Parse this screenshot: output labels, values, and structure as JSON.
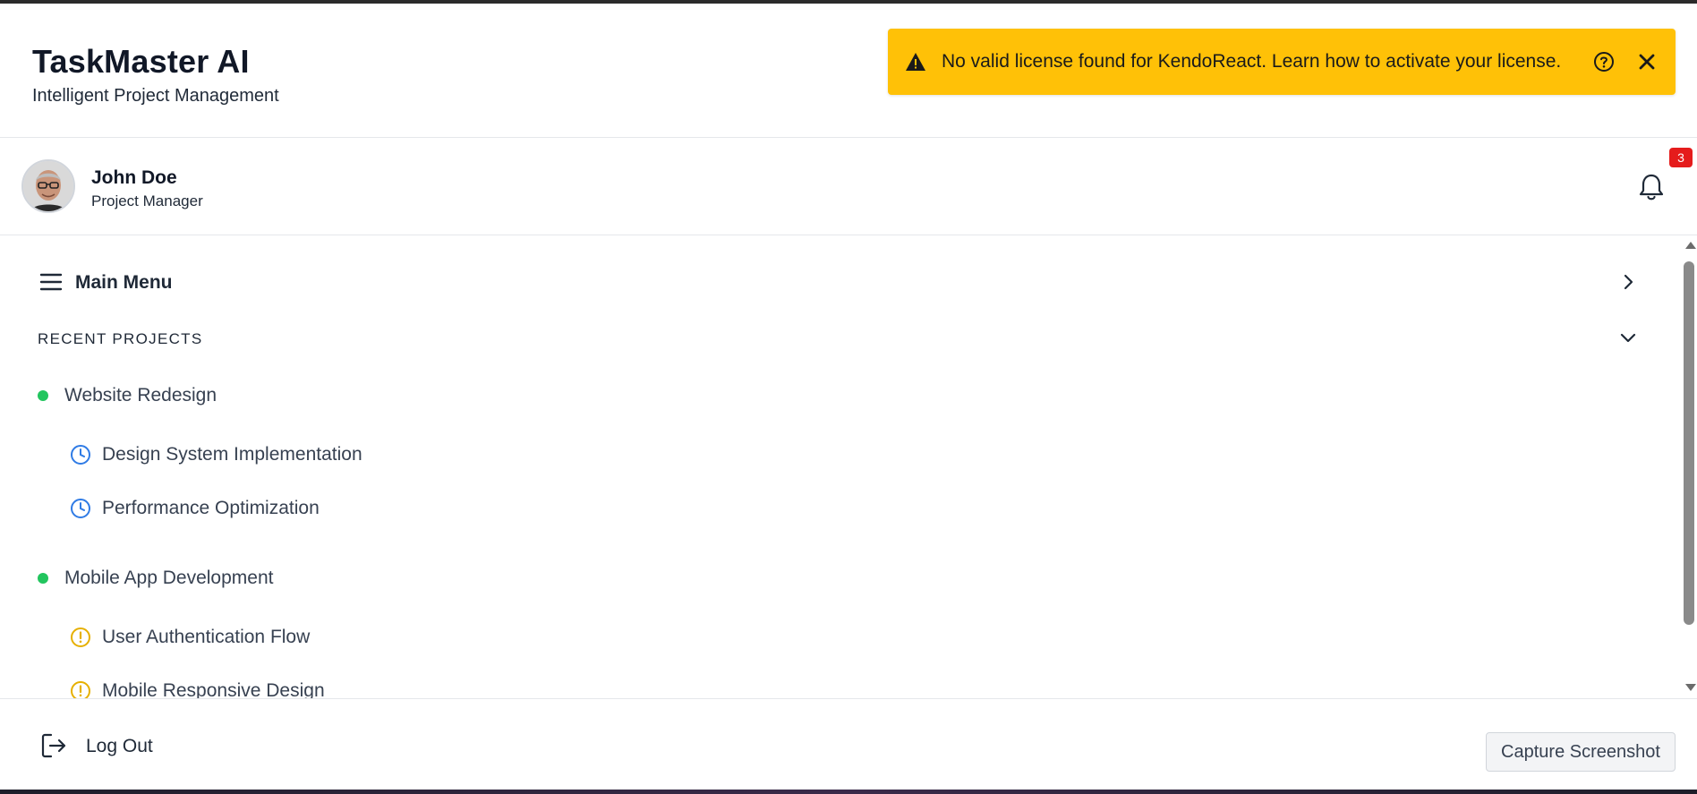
{
  "app": {
    "title": "TaskMaster AI",
    "subtitle": "Intelligent Project Management"
  },
  "license_banner": {
    "message": "No valid license found for KendoReact. Learn how to activate your license.",
    "background": "#ffc107",
    "icons": [
      "warning-icon",
      "help-circle-icon",
      "close-icon"
    ]
  },
  "user": {
    "name": "John Doe",
    "role": "Project Manager",
    "notifications": "3"
  },
  "menu": {
    "main_label": "Main Menu",
    "section_label": "RECENT PROJECTS"
  },
  "projects": [
    {
      "name": "Website Redesign",
      "status_color": "#22c55e",
      "tasks": [
        {
          "name": "Design System Implementation",
          "icon": "clock-icon",
          "color": "#2f7be5"
        },
        {
          "name": "Performance Optimization",
          "icon": "clock-icon",
          "color": "#2f7be5"
        }
      ]
    },
    {
      "name": "Mobile App Development",
      "status_color": "#22c55e",
      "tasks": [
        {
          "name": "User Authentication Flow",
          "icon": "alert-circle-icon",
          "color": "#e6b000"
        },
        {
          "name": "Mobile Responsive Design",
          "icon": "alert-circle-icon",
          "color": "#e6b000"
        }
      ]
    }
  ],
  "footer": {
    "logout_label": "Log Out",
    "capture_label": "Capture Screenshot"
  }
}
